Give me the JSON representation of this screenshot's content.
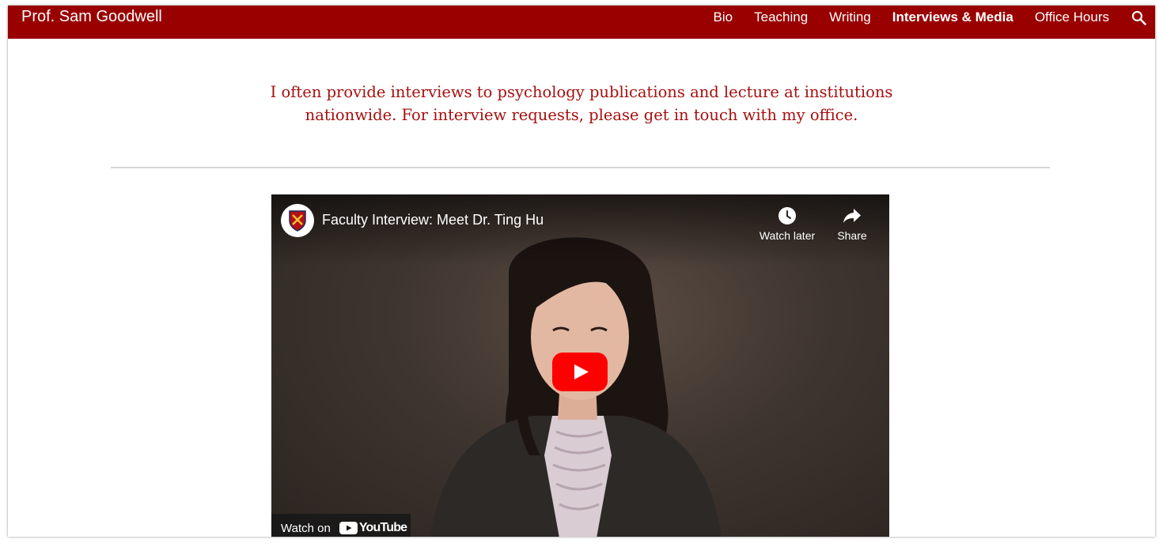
{
  "site": {
    "title": "Prof. Sam Goodwell"
  },
  "nav": {
    "items": [
      {
        "label": "Bio"
      },
      {
        "label": "Teaching"
      },
      {
        "label": "Writing"
      },
      {
        "label": "Interviews & Media",
        "active": true
      },
      {
        "label": "Office Hours"
      }
    ],
    "search_icon": "search-icon"
  },
  "intro": {
    "text": "I often provide interviews to psychology publications and lecture at institutions nationwide. For interview requests, please get in touch with my office."
  },
  "video": {
    "title": "Faculty Interview: Meet Dr. Ting Hu",
    "watch_later_label": "Watch later",
    "share_label": "Share",
    "watch_on_label": "Watch on",
    "youtube_wordmark": "YouTube",
    "icons": [
      "channel-crest-icon",
      "clock-icon",
      "share-arrow-icon",
      "play-icon",
      "youtube-logo-icon"
    ]
  },
  "colors": {
    "brand": "#990000",
    "intro_text": "#a50f0f",
    "youtube_red": "#ff0000"
  }
}
